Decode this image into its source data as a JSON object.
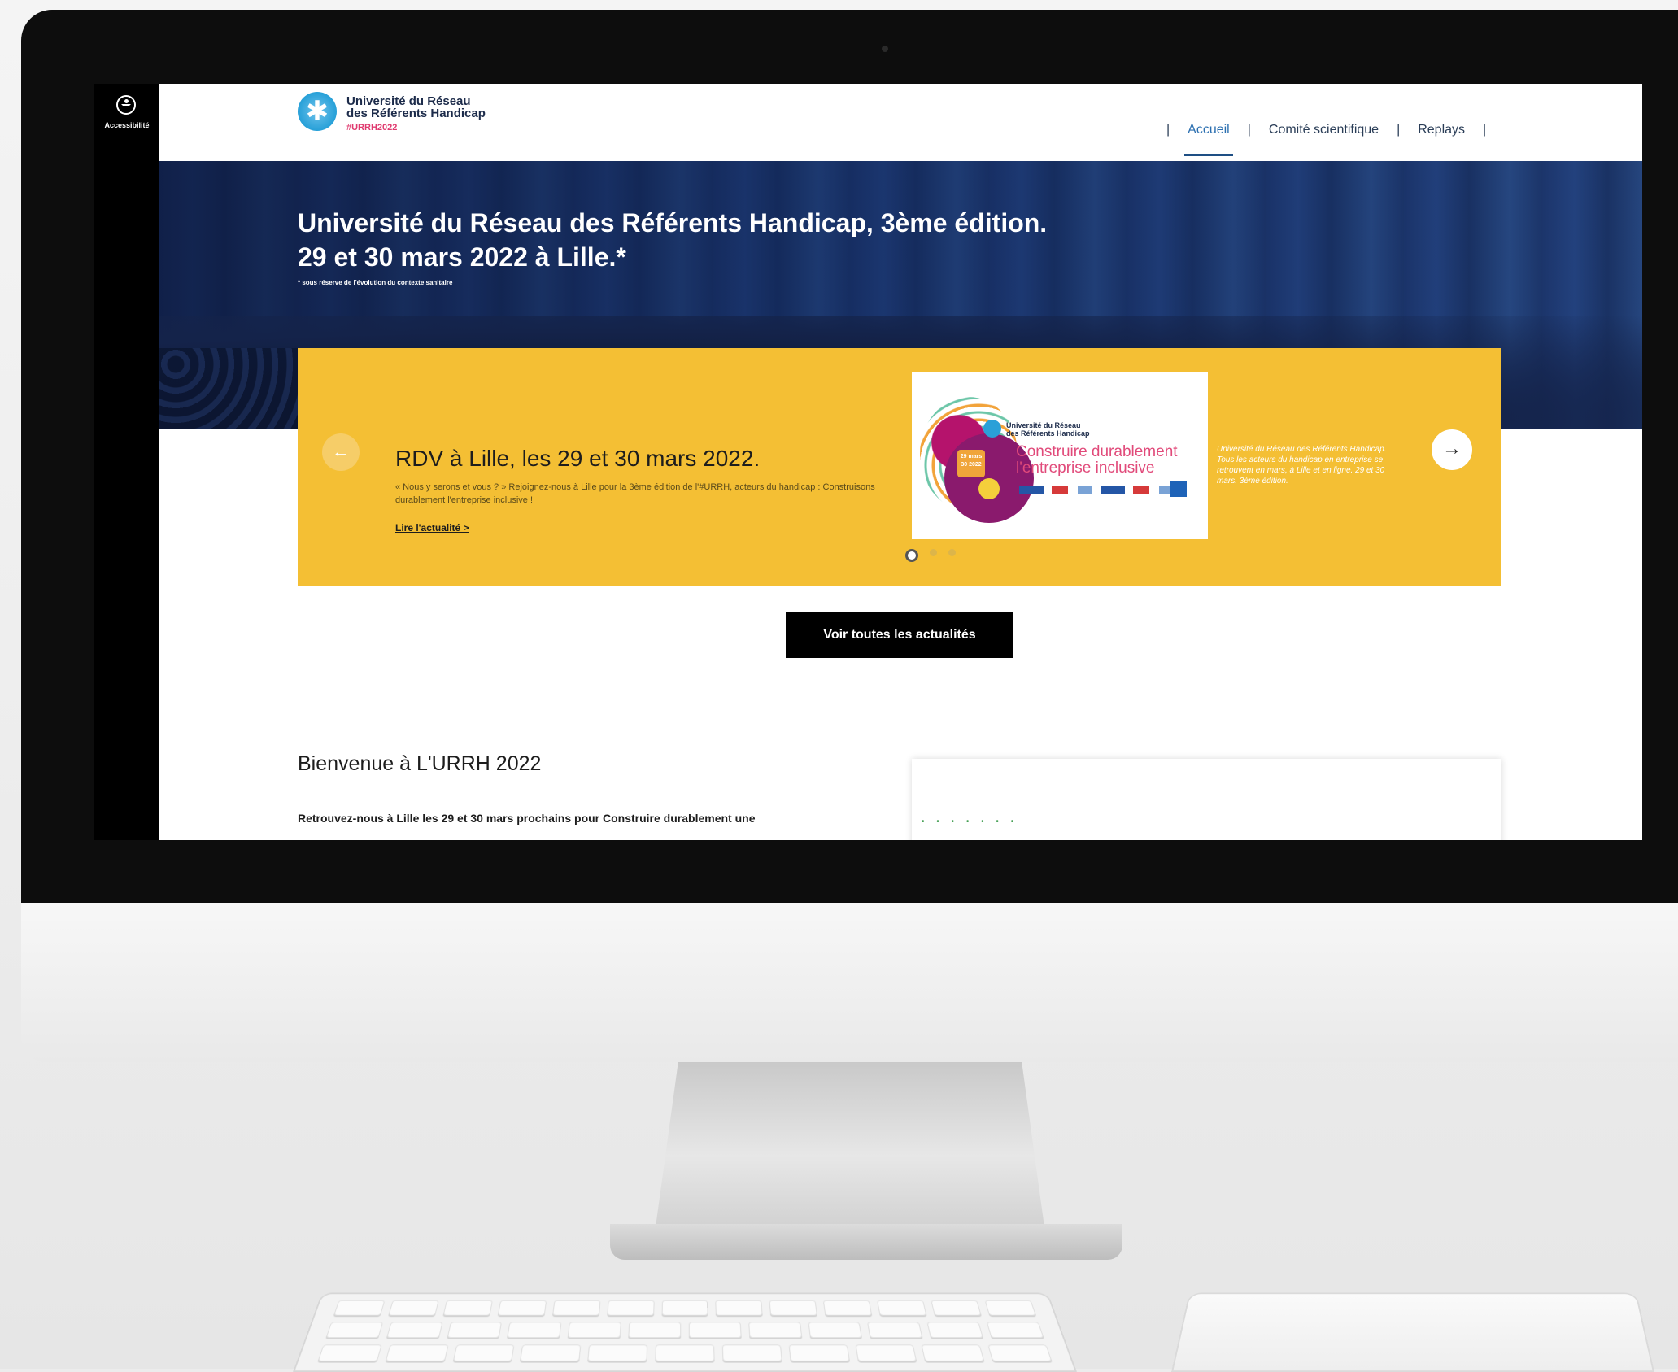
{
  "accessibility": {
    "label": "Accessibilité"
  },
  "site": {
    "logo_title_line1": "Université du Réseau",
    "logo_title_line2": "des Référents Handicap",
    "logo_tag": "#URRH2022"
  },
  "nav": {
    "separator": "|",
    "items": [
      {
        "label": "Accueil",
        "active": true
      },
      {
        "label": "Comité scientifique",
        "active": false
      },
      {
        "label": "Replays",
        "active": false
      }
    ]
  },
  "hero": {
    "title_line1": "Université du Réseau des Référents Handicap, 3ème édition.",
    "title_line2": "29 et 30 mars 2022 à Lille.*",
    "note": "* sous réserve de l'évolution du contexte sanitaire"
  },
  "slider": {
    "prev_icon": "arrow-left-icon",
    "next_icon": "arrow-right-icon",
    "prev_glyph": "←",
    "next_glyph": "→",
    "title": "RDV à Lille, les 29 et 30 mars 2022.",
    "description": "« Nous y serons et vous ? » Rejoignez-nous à Lille pour la 3ème édition de l'#URRH, acteurs du handicap : Construisons durablement l'entreprise inclusive !",
    "link": "Lire l'actualité >",
    "image": {
      "header_line1": "Université du Réseau",
      "header_line2": "des Référents Handicap",
      "date": "29 mars 30 2022",
      "headline_line1": "Construire durablement",
      "headline_line2": "l'entreprise inclusive"
    },
    "caption": "Université du Réseau des Référents Handicap. Tous les acteurs du handicap en entreprise se retrouvent en mars, à Lille et en ligne. 29 et 30 mars. 3ème édition.",
    "active_index": 0,
    "count": 3
  },
  "actions": {
    "all_news": "Voir toutes les actualités"
  },
  "welcome": {
    "title": "Bienvenue à L'URRH 2022",
    "text": "Retrouvez-nous à Lille les 29 et 30 mars prochains pour Construire durablement une"
  },
  "colors": {
    "accent_yellow": "#f4bf34",
    "nav_active": "#2b6fb0",
    "logo_blue": "#27a0d8",
    "tag_pink": "#e03a6f"
  }
}
